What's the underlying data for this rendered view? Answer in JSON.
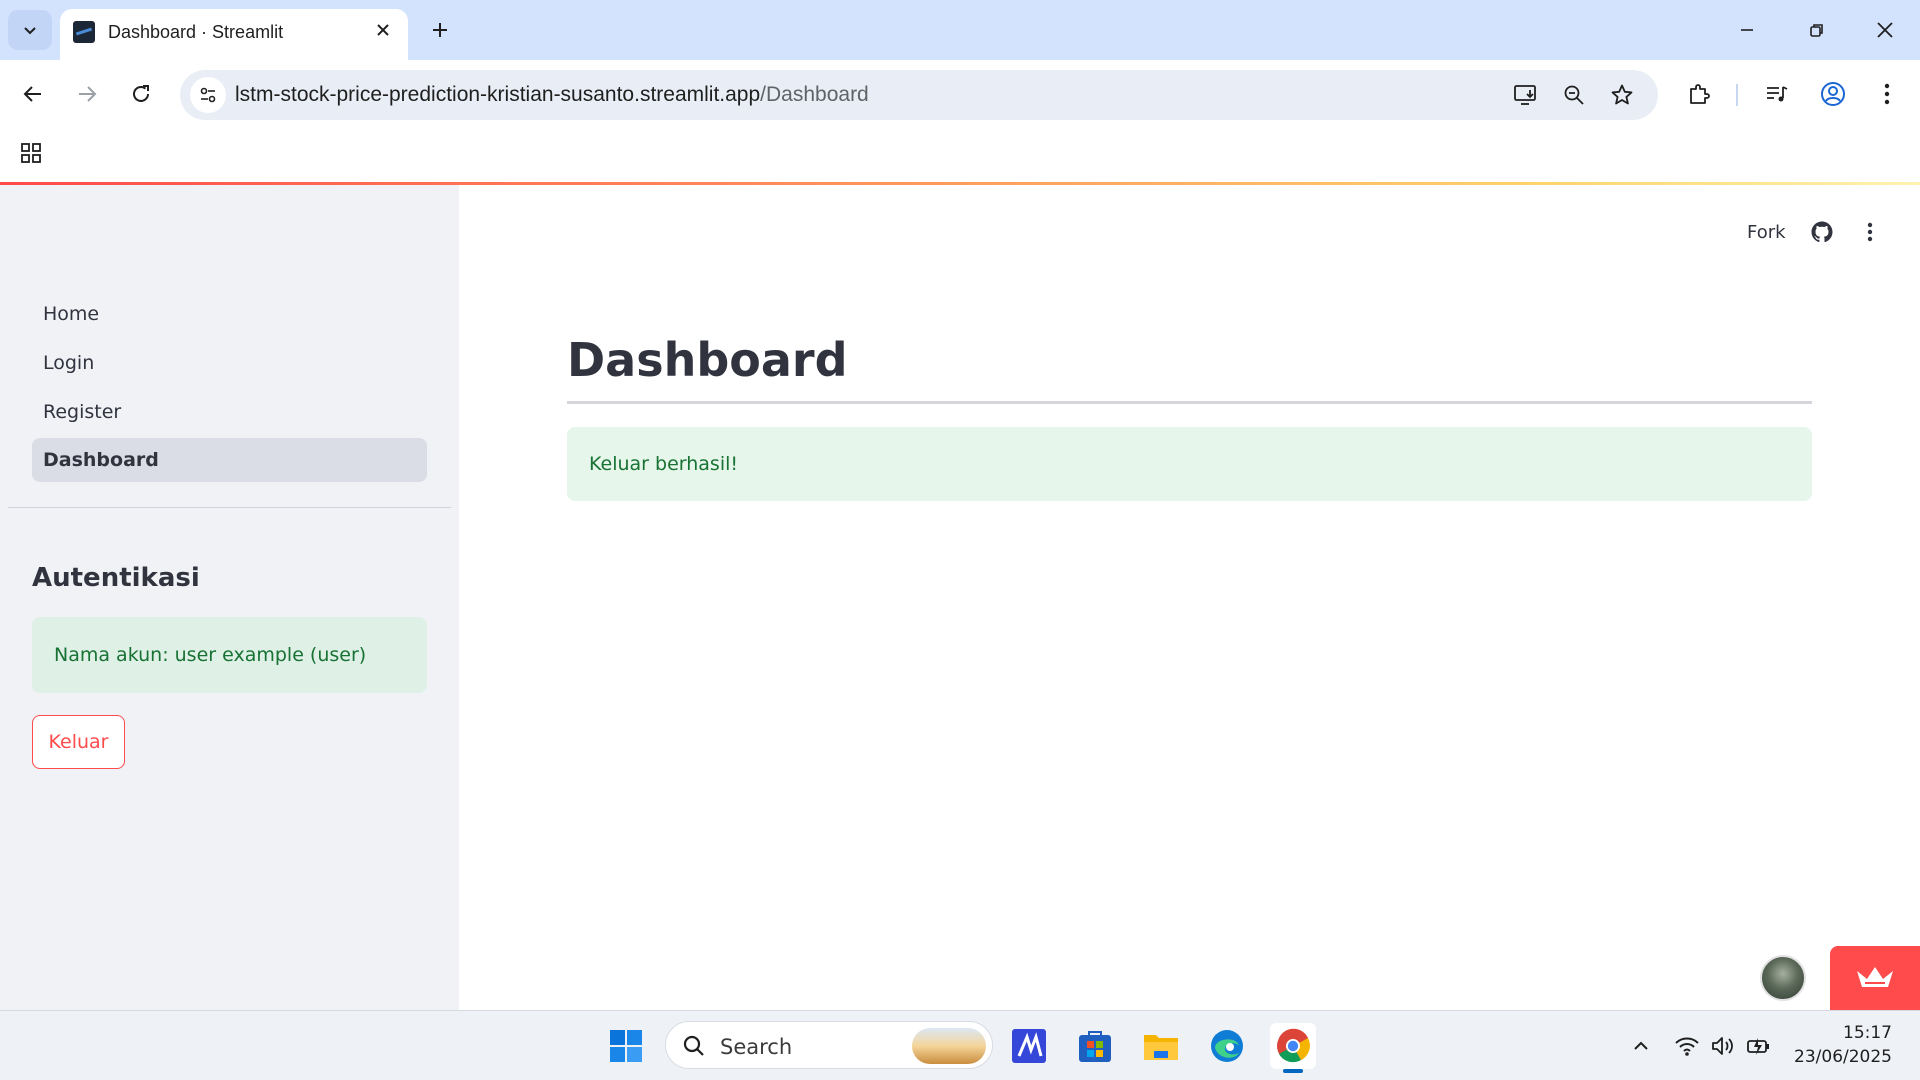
{
  "browser": {
    "tab_title": "Dashboard · Streamlit",
    "url_host": "lstm-stock-price-prediction-kristian-susanto.streamlit.app",
    "url_path": "/Dashboard"
  },
  "header": {
    "fork_label": "Fork"
  },
  "sidebar": {
    "nav_items": [
      {
        "label": "Home",
        "active": false
      },
      {
        "label": "Login",
        "active": false
      },
      {
        "label": "Register",
        "active": false
      },
      {
        "label": "Dashboard",
        "active": true
      }
    ],
    "section_heading": "Autentikasi",
    "account_info": "Nama akun: user example (user)",
    "logout_label": "Keluar"
  },
  "main": {
    "title": "Dashboard",
    "success_message": "Keluar berhasil!"
  },
  "taskbar": {
    "search_placeholder": "Search",
    "time": "15:17",
    "date": "23/06/2025"
  },
  "colors": {
    "accent_red": "#ff4b4b",
    "success_green_text": "#177233",
    "sidebar_bg": "#f0f2f6",
    "chrome_tabbar": "#d3e3fd"
  },
  "icons": [
    "tab-search-icon",
    "close-icon",
    "plus-icon",
    "minimize-icon",
    "restore-icon",
    "back-icon",
    "forward-icon",
    "reload-icon",
    "site-info-icon",
    "install-icon",
    "zoom-icon",
    "star-icon",
    "extensions-icon",
    "media-icon",
    "profile-icon",
    "kebab-icon",
    "apps-icon",
    "github-icon",
    "streamlit-crown-icon",
    "windows-start-icon",
    "search-icon",
    "wifi-icon",
    "volume-icon",
    "battery-icon",
    "chevron-up-icon"
  ]
}
